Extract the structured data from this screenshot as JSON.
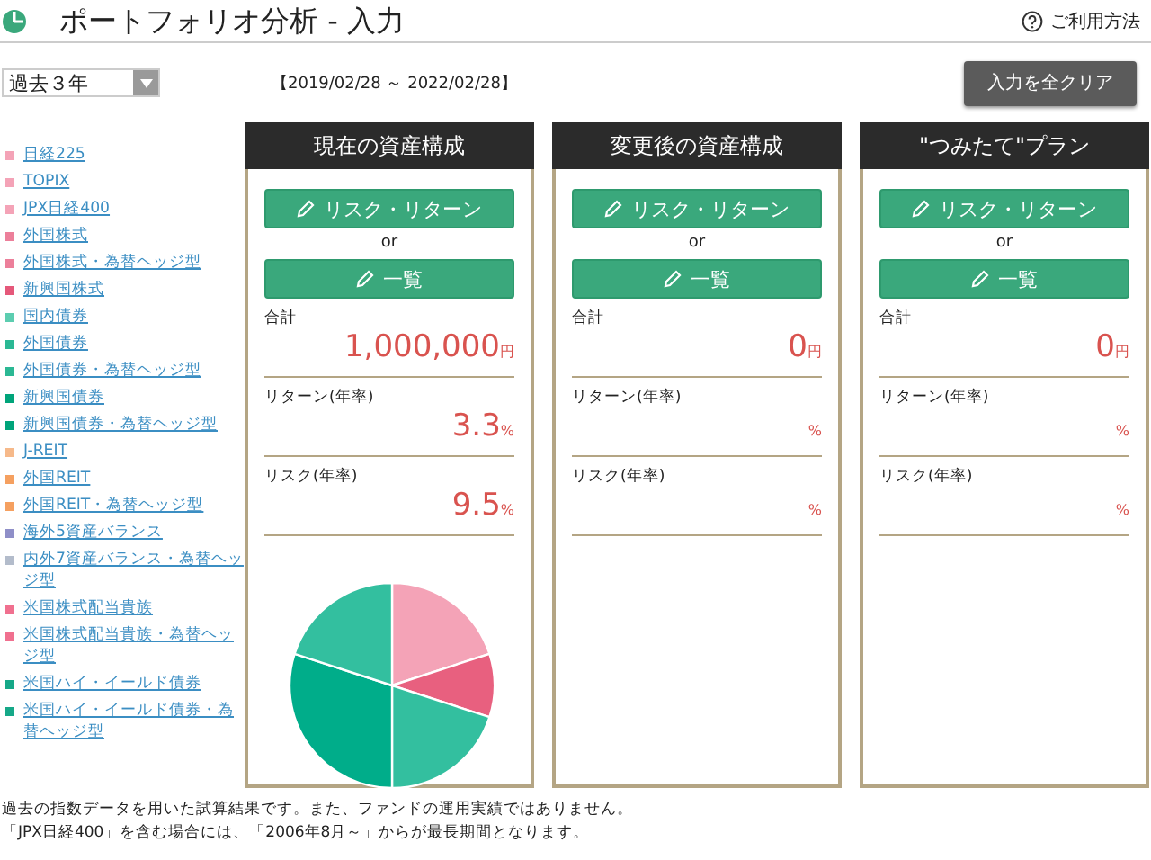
{
  "header": {
    "title": "ポートフォリオ分析 - 入力",
    "help_link": "ご利用方法"
  },
  "period_select": {
    "value": "過去３年"
  },
  "date_range": "【2019/02/28 ～ 2022/02/28】",
  "clear_button": "入力を全クリア",
  "legend": [
    {
      "label": "日経225",
      "color": "#f4a3b7"
    },
    {
      "label": "TOPIX",
      "color": "#f4a3b7"
    },
    {
      "label": "JPX日経400",
      "color": "#f4a3b7"
    },
    {
      "label": "外国株式",
      "color": "#ec7f9a"
    },
    {
      "label": "外国株式・為替ヘッジ型",
      "color": "#ec7f9a"
    },
    {
      "label": "新興国株式",
      "color": "#e5587a"
    },
    {
      "label": "国内債券",
      "color": "#5ccdb0"
    },
    {
      "label": "外国債券",
      "color": "#2bb894"
    },
    {
      "label": "外国債券・為替ヘッジ型",
      "color": "#2bb894"
    },
    {
      "label": "新興国債券",
      "color": "#00a47a"
    },
    {
      "label": "新興国債券・為替ヘッジ型",
      "color": "#00a47a"
    },
    {
      "label": "J-REIT",
      "color": "#f6b98a"
    },
    {
      "label": "外国REIT",
      "color": "#f5a060"
    },
    {
      "label": "外国REIT・為替ヘッジ型",
      "color": "#f5a060"
    },
    {
      "label": "海外5資産バランス",
      "color": "#8f8fc8"
    },
    {
      "label": "内外7資産バランス・為替ヘッジ型",
      "color": "#b3bccb"
    },
    {
      "label": "米国株式配当貴族",
      "color": "#f0708f"
    },
    {
      "label": "米国株式配当貴族・為替ヘッジ型",
      "color": "#f0708f"
    },
    {
      "label": "米国ハイ・イールド債券",
      "color": "#16a888"
    },
    {
      "label": "米国ハイ・イールド債券・為替ヘッジ型",
      "color": "#16a888"
    }
  ],
  "panels": [
    {
      "title": "現在の資産構成",
      "risk_return_button": "リスク・リターン",
      "or": "or",
      "list_button": "一覧",
      "total_label": "合計",
      "total_value": "1,000,000",
      "total_unit": "円",
      "return_label": "リターン(年率)",
      "return_value": "3.3",
      "return_unit": "%",
      "risk_label": "リスク(年率)",
      "risk_value": "9.5",
      "risk_unit": "%",
      "pie": true
    },
    {
      "title": "変更後の資産構成",
      "risk_return_button": "リスク・リターン",
      "or": "or",
      "list_button": "一覧",
      "total_label": "合計",
      "total_value": "0",
      "total_unit": "円",
      "return_label": "リターン(年率)",
      "return_unit": "%",
      "risk_label": "リスク(年率)",
      "risk_unit": "%",
      "pie": false
    },
    {
      "title": "\"つみたて\"プラン",
      "risk_return_button": "リスク・リターン",
      "or": "or",
      "list_button": "一覧",
      "total_label": "合計",
      "total_value": "0",
      "total_unit": "円",
      "return_label": "リターン(年率)",
      "return_unit": "%",
      "risk_label": "リスク(年率)",
      "risk_unit": "%",
      "pie": false
    }
  ],
  "notes": [
    "過去の指数データを用いた試算結果です。また、ファンドの運用実績ではありません。",
    "「JPX日経400」を含む場合には、「2006年8月～」からが最長期間となります。"
  ]
}
